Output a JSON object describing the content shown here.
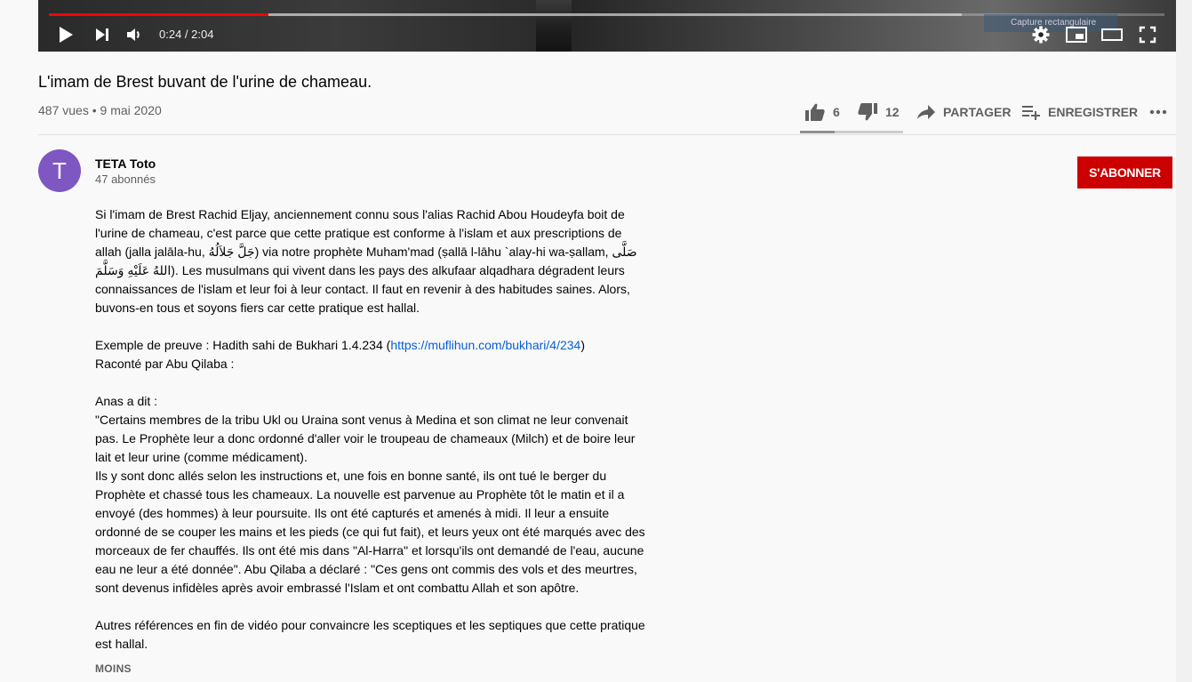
{
  "player": {
    "time_current": "0:24",
    "time_separator": " / ",
    "time_total": "2:04",
    "progress_played": 0.197,
    "progress_buffered": 0.818,
    "tooltip": "Capture rectangulaire"
  },
  "video": {
    "title": "L'imam de Brest buvant de l'urine de chameau.",
    "views": "487 vues",
    "dot": " • ",
    "date": "9 mai 2020"
  },
  "actions": {
    "likes": "6",
    "dislikes": "12",
    "like_ratio": 0.333,
    "share": "PARTAGER",
    "save": "ENREGISTRER"
  },
  "channel": {
    "avatar_letter": "T",
    "name": "TETA Toto",
    "subscribers": "47 abonnés",
    "subscribe_label": "S'ABONNER"
  },
  "description": {
    "p1": "Si l'imam de Brest Rachid Eljay, anciennement connu sous l'alias Rachid Abou Houdeyfa boit de l'urine de chameau, c'est parce que cette pratique est conforme à l'islam et aux prescriptions de allah (jalla jalāla-hu, جَلَّ جَلاَلُهُ) via notre prophète Muham'mad (ṣallā l-lāhu `alay-hi wa-ṣallam, صَلَّى اللهُ عَلَيْهِ وَسَلَّمَ). Les musulmans qui vivent dans les pays des alkufaar alqadhara dégradent leurs connaissances de l'islam et leur foi à leur contact. Il faut en revenir à des habitudes saines. Alors, buvons-en tous et soyons fiers car cette pratique est hallal.",
    "proof_prefix": "Exemple de preuve : Hadith sahi de Bukhari 1.4.234 (",
    "proof_link": "https://muflihun.com/bukhari/4/234",
    "proof_suffix": ")",
    "narrated": "Raconté par Abu Qilaba :",
    "anas": "Anas a dit :",
    "quote1": "\"Certains membres de la tribu Ukl ou Uraina sont venus à Medina et son climat ne leur convenait pas. Le Prophète leur a donc ordonné d'aller voir le troupeau de chameaux (Milch) et de boire leur lait et leur urine (comme médicament).",
    "quote2": "Ils y sont donc allés selon les instructions et, une fois en bonne santé, ils ont tué le berger du Prophète et chassé tous les chameaux. La nouvelle est parvenue au Prophète tôt le matin et il a envoyé (des hommes) à leur poursuite. Ils ont été capturés et amenés à midi. Il leur a ensuite ordonné de se couper les mains et les pieds (ce qui fut fait), et leurs yeux ont été marqués avec des morceaux de fer chauffés. Ils ont été mis dans \"Al-Harra\" et lorsqu'ils ont demandé de l'eau, aucune eau ne leur a été donnée\". Abu Qilaba a déclaré : \"Ces gens ont commis des vols et des meurtres, sont devenus infidèles après avoir embrassé l'Islam et ont combattu Allah et son apôtre.",
    "closing": "Autres références en fin de vidéo pour convaincre les sceptiques et les septiques que cette pratique est hallal.",
    "less_label": "MOINS"
  },
  "icons": {
    "play": "play-icon",
    "next": "next-icon",
    "volume": "volume-icon",
    "settings": "gear-icon",
    "miniplayer": "miniplayer-icon",
    "theater": "theater-icon",
    "fullscreen": "fullscreen-icon",
    "like": "thumbs-up-icon",
    "dislike": "thumbs-down-icon",
    "share": "share-arrow-icon",
    "save": "playlist-add-icon",
    "more": "more-dots-icon"
  },
  "colors": {
    "progress": "#ff0000",
    "subscribe": "#cc0000",
    "avatar": "#7e57c2",
    "link": "#065fd4"
  }
}
